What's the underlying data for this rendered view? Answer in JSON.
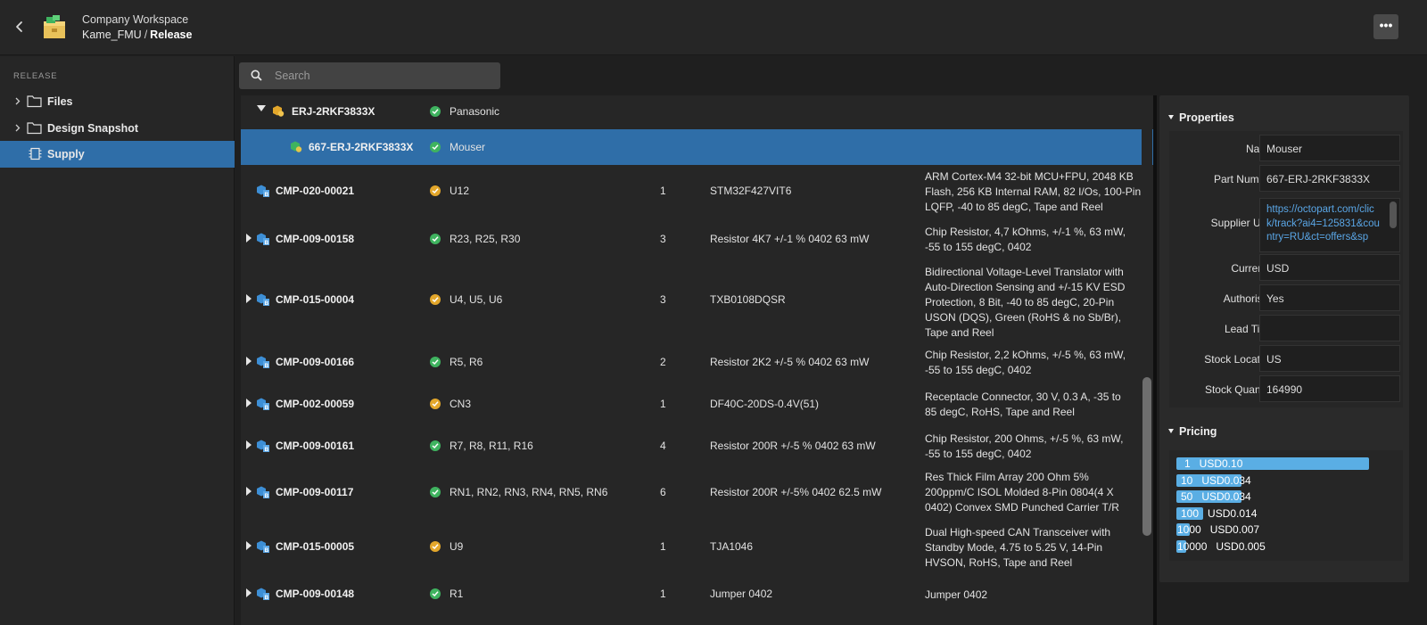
{
  "header": {
    "workspace": "Company Workspace",
    "project": "Kame_FMU",
    "separator": "/",
    "section": "Release",
    "more_label": "•••"
  },
  "sidebar": {
    "heading": "RELEASE",
    "items": [
      {
        "label": "Files"
      },
      {
        "label": "Design Snapshot"
      },
      {
        "label": "Supply"
      }
    ]
  },
  "search": {
    "placeholder": "Search"
  },
  "table": {
    "rows": [
      {
        "id": "ERJ-2RKF3833X",
        "status": "ok",
        "designators": "Panasonic",
        "qty": "",
        "mpn": "",
        "desc": []
      },
      {
        "id": "667-ERJ-2RKF3833X",
        "status": "ok",
        "designators": "Mouser",
        "qty": "",
        "mpn": "",
        "desc": []
      },
      {
        "id": "CMP-020-00021",
        "status": "warn",
        "designators": "U12",
        "qty": "1",
        "mpn": "STM32F427VIT6",
        "desc": [
          "ARM Cortex-M4 32-bit MCU+FPU, 2048 KB",
          "Flash, 256 KB Internal RAM, 82 I/Os, 100-Pin",
          "LQFP, -40 to 85 degC, Tape and Reel"
        ]
      },
      {
        "id": "CMP-009-00158",
        "status": "ok",
        "designators": "R23, R25, R30",
        "qty": "3",
        "mpn": "Resistor 4K7 +/-1 % 0402 63 mW",
        "desc": [
          "Chip Resistor, 4,7 kOhms, +/-1 %, 63 mW,",
          "-55 to 155 degC, 0402"
        ]
      },
      {
        "id": "CMP-015-00004",
        "status": "warn",
        "designators": "U4, U5, U6",
        "qty": "3",
        "mpn": "TXB0108DQSR",
        "desc": [
          "Bidirectional Voltage-Level Translator with",
          "Auto-Direction Sensing and +/-15 KV ESD",
          "Protection, 8 Bit, -40 to 85 degC, 20-Pin",
          "USON (DQS), Green (RoHS & no Sb/Br),",
          "Tape and Reel"
        ]
      },
      {
        "id": "CMP-009-00166",
        "status": "ok",
        "designators": "R5, R6",
        "qty": "2",
        "mpn": "Resistor 2K2 +/-5 % 0402 63 mW",
        "desc": [
          "Chip Resistor, 2,2 kOhms, +/-5 %, 63 mW,",
          "-55 to 155 degC, 0402"
        ]
      },
      {
        "id": "CMP-002-00059",
        "status": "warn",
        "designators": "CN3",
        "qty": "1",
        "mpn": "DF40C-20DS-0.4V(51)",
        "desc": [
          "Receptacle Connector, 30 V, 0.3 A, -35 to",
          "85 degC, RoHS, Tape and Reel"
        ]
      },
      {
        "id": "CMP-009-00161",
        "status": "ok",
        "designators": "R7, R8, R11, R16",
        "qty": "4",
        "mpn": "Resistor 200R +/-5 % 0402 63 mW",
        "desc": [
          "Chip Resistor, 200 Ohms, +/-5 %, 63 mW,",
          "-55 to 155 degC, 0402"
        ]
      },
      {
        "id": "CMP-009-00117",
        "status": "ok",
        "designators": "RN1, RN2, RN3, RN4, RN5, RN6",
        "qty": "6",
        "mpn": "Resistor 200R +/-5% 0402 62.5 mW",
        "desc": [
          "Res Thick Film Array 200 Ohm 5%",
          "200ppm/C ISOL Molded 8-Pin 0804(4 X",
          "0402) Convex SMD Punched Carrier T/R"
        ]
      },
      {
        "id": "CMP-015-00005",
        "status": "warn",
        "designators": "U9",
        "qty": "1",
        "mpn": "TJA1046",
        "desc": [
          "Dual High-speed CAN Transceiver with",
          "Standby Mode, 4.75 to 5.25 V, 14-Pin",
          "HVSON, RoHS, Tape and Reel"
        ]
      },
      {
        "id": "CMP-009-00148",
        "status": "ok",
        "designators": "R1",
        "qty": "1",
        "mpn": "Jumper 0402",
        "desc": [
          "Jumper 0402"
        ]
      }
    ]
  },
  "properties": {
    "title": "Properties",
    "name_label": "Name",
    "name_value": "Mouser",
    "part_label": "Part Number",
    "part_value": "667-ERJ-2RKF3833X",
    "url_label": "Supplier URL",
    "url_value": "https://octopart.com/click/track?ai4=125831&country=RU&ct=offers&sp",
    "currency_label": "Currency",
    "currency_value": "USD",
    "auth_label": "Authorised",
    "auth_value": "Yes",
    "lead_label": "Lead Time",
    "lead_value": "",
    "loc_label": "Stock Location",
    "loc_value": "US",
    "qty_label": "Stock Quantity",
    "qty_value": "164990"
  },
  "pricing": {
    "title": "Pricing",
    "breaks": [
      {
        "qty": "1",
        "price": "USD0.10",
        "fraction": 1.0
      },
      {
        "qty": "10",
        "price": "USD0.034",
        "fraction": 0.34
      },
      {
        "qty": "50",
        "price": "USD0.034",
        "fraction": 0.34
      },
      {
        "qty": "100",
        "price": "USD0.014",
        "fraction": 0.14
      },
      {
        "qty": "1000",
        "price": "USD0.007",
        "fraction": 0.07
      },
      {
        "qty": "10000",
        "price": "USD0.005",
        "fraction": 0.05
      }
    ]
  },
  "colors": {
    "accent": "#2f6ea8",
    "ok": "#3fb35f",
    "warn": "#e3a72b",
    "price_bar": "#5aaee4",
    "link": "#5aa6e6"
  }
}
